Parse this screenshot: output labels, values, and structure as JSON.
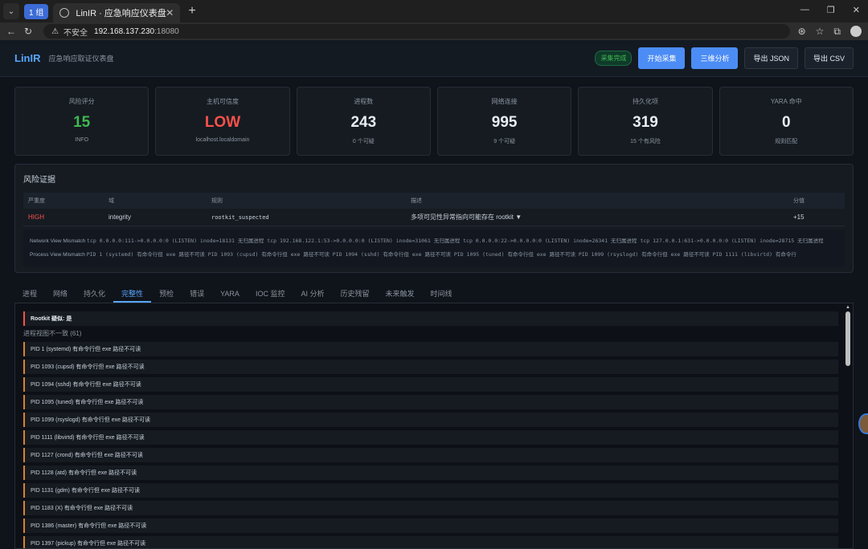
{
  "browser": {
    "group_label": "1 组",
    "tab_title": "LinIR · 应急响应仪表盘",
    "insecure_label": "不安全",
    "url_host": "192.168.137.230",
    "url_port": ":18080"
  },
  "header": {
    "logo": "LinIR",
    "subtitle": "应急响应取证仪表盘",
    "status": "采集完成",
    "btn_start": "开始采集",
    "btn_3d": "三维分析",
    "btn_json": "导出 JSON",
    "btn_csv": "导出 CSV"
  },
  "cards": [
    {
      "label": "风险评分",
      "value": "15",
      "sub": "INFO"
    },
    {
      "label": "主机可信度",
      "value": "LOW",
      "sub": "localhost.localdomain"
    },
    {
      "label": "进程数",
      "value": "243",
      "sub": "0 个可疑"
    },
    {
      "label": "网络连接",
      "value": "995",
      "sub": "9 个可疑"
    },
    {
      "label": "持久化项",
      "value": "319",
      "sub": "15 个有风险"
    },
    {
      "label": "YARA 命中",
      "value": "0",
      "sub": "规则匹配"
    }
  ],
  "evidence": {
    "title": "风险证据",
    "columns": [
      "严重度",
      "域",
      "规则",
      "描述",
      "分值"
    ],
    "row": {
      "severity": "HIGH",
      "domain": "integrity",
      "rule": "rootkit_suspected",
      "desc": "多项可见性异常指向可能存在 rootkit ▼",
      "score": "+15"
    },
    "network_label": "Network View Mismatch",
    "network_text": "tcp 0.0.0.0:111->0.0.0.0:0 (LISTEN) inode=18131 无归属进程  tcp 192.168.122.1:53->0.0.0.0:0 (LISTEN) inode=31061 无归属进程  tcp 0.0.0.0:22->0.0.0.0:0 (LISTEN) inode=26341 无归属进程  tcp 127.0.0.1:631->0.0.0.0:0 (LISTEN) inode=28715 无归属进程",
    "process_label": "Process View Mismatch",
    "process_text": "PID 1 (systemd) 有命令行但 exe 路径不可读  PID 1093 (cupsd) 有命令行但 exe 路径不可读  PID 1094 (sshd) 有命令行但 exe 路径不可读  PID 1095 (tuned) 有命令行但 exe 路径不可读  PID 1099 (rsyslogd) 有命令行但 exe 路径不可读  PID 1111 (libvirtd) 有命令行"
  },
  "tabs": [
    "进程",
    "网络",
    "持久化",
    "完整性",
    "预检",
    "错误",
    "YARA",
    "IOC 监控",
    "AI 分析",
    "历史残留",
    "未来触发",
    "时间线"
  ],
  "list": {
    "rootkit": "Rootkit 疑似: 是",
    "section": "进程视图不一致 (61)",
    "items": [
      "PID 1 (systemd) 有命令行但 exe 路径不可读",
      "PID 1093 (cupsd) 有命令行但 exe 路径不可读",
      "PID 1094 (sshd) 有命令行但 exe 路径不可读",
      "PID 1095 (tuned) 有命令行但 exe 路径不可读",
      "PID 1099 (rsyslogd) 有命令行但 exe 路径不可读",
      "PID 1111 (libvirtd) 有命令行但 exe 路径不可读",
      "PID 1127 (crond) 有命令行但 exe 路径不可读",
      "PID 1128 (atd) 有命令行但 exe 路径不可读",
      "PID 1131 (gdm) 有命令行但 exe 路径不可读",
      "PID 1183 (X) 有命令行但 exe 路径不可读",
      "PID 1386 (master) 有命令行但 exe 路径不可读",
      "PID 1397 (pickup) 有命令行但 exe 路径不可读"
    ]
  }
}
